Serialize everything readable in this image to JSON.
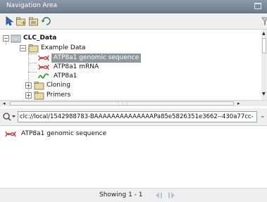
{
  "window": {
    "title": "Navigation Area"
  },
  "toolbar": {
    "icons": [
      "pointer-icon",
      "add-folder-icon",
      "add-location-icon",
      "refresh-icon",
      "filter-icon"
    ]
  },
  "tree": {
    "root": {
      "label": "CLC_Data",
      "expanded": true
    },
    "example_data": {
      "label": "Example Data",
      "expanded": true
    },
    "items": [
      {
        "label": "ATP8a1 genomic sequence",
        "icon": "dna-sequence-icon",
        "selected": true
      },
      {
        "label": "ATP8a1 mRNA",
        "icon": "dna-sequence-icon",
        "selected": false
      },
      {
        "label": "ATP8a1",
        "icon": "protein-sequence-icon",
        "selected": false
      },
      {
        "label": "Cloning",
        "icon": "folder-icon",
        "selected": false
      },
      {
        "label": "Primers",
        "icon": "folder-icon",
        "selected": false
      }
    ]
  },
  "search": {
    "value": "clc://local/1542988783-BAAAAAAAAAAAAAAPa85e5826351e3662--430a77cc-"
  },
  "results": [
    {
      "label": "ATP8a1 genomic sequence",
      "icon": "dna-sequence-icon"
    }
  ],
  "status": {
    "showing": "Showing 1 - 1"
  },
  "colors": {
    "titlebar": "#7d8b9a",
    "selection": "#8e979e",
    "dna_icon": "#c23a3a",
    "protein_icon": "#3a9a3a",
    "folder": "#e4d6a4"
  }
}
